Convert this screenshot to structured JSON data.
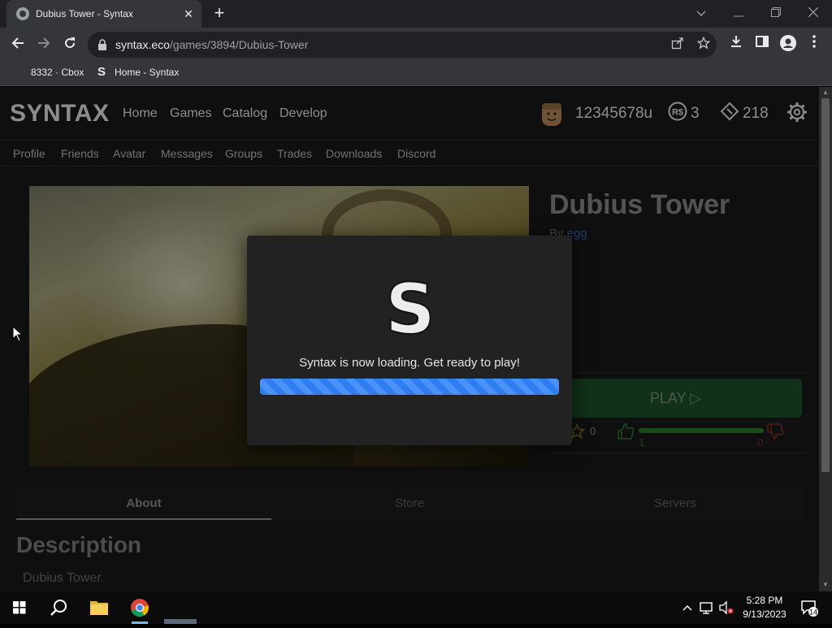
{
  "browser": {
    "tab_title": "Dubius Tower - Syntax",
    "tab_close": "✕",
    "new_tab": "+",
    "url_domain": "syntax.eco",
    "url_path": "/games/3894/Dubius-Tower",
    "bookmarks": [
      {
        "label": "8332 · Cbox"
      },
      {
        "label": "Home - Syntax"
      }
    ],
    "bookmark_icon": "S"
  },
  "site": {
    "logo": "SYNTAX",
    "nav": [
      "Home",
      "Games",
      "Catalog",
      "Develop"
    ],
    "username": "12345678u",
    "robux": "3",
    "tickets": "218",
    "subnav": [
      "Profile",
      "Friends",
      "Avatar",
      "Messages",
      "Groups",
      "Trades",
      "Downloads",
      "Discord"
    ]
  },
  "game": {
    "title": "Dubius Tower",
    "by_label": "By",
    "creator": "egg",
    "play_label": "PLAY ▷",
    "favorites": "0",
    "likes": "1",
    "dislikes": "0",
    "like_fraction": 1.0
  },
  "tabs": [
    "About",
    "Store",
    "Servers"
  ],
  "about": {
    "heading": "Description",
    "text": "Dubius Tower."
  },
  "modal": {
    "logo_letter": "S",
    "message": "Syntax is now loading. Get ready to play!",
    "progress_fraction": 1.0
  },
  "taskbar": {
    "time": "5:28 PM",
    "date": "9/13/2023",
    "notifications": "14"
  },
  "colors": {
    "play": "#1f5a2e",
    "progress": "#2f7df0",
    "creator_link": "#3d6fb5"
  }
}
